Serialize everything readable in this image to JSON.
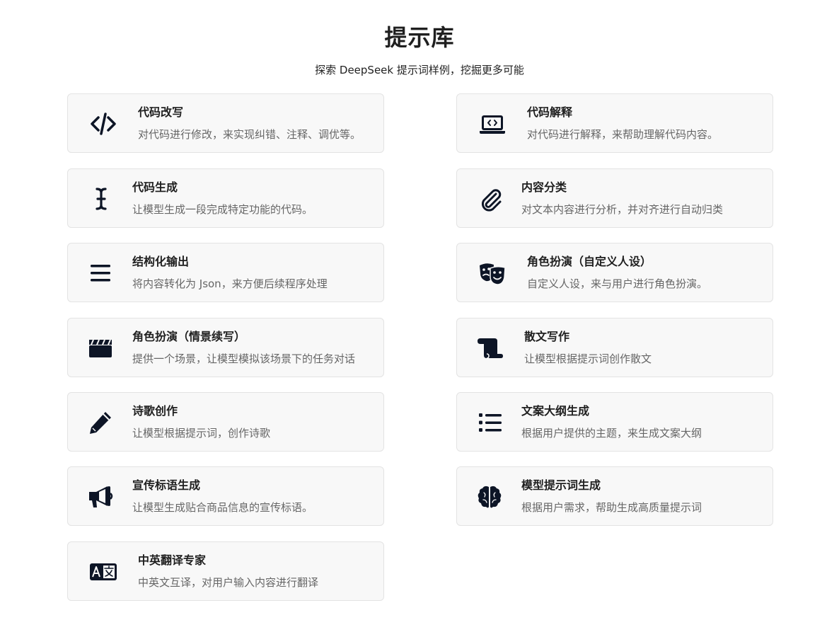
{
  "header": {
    "title": "提示库",
    "subtitle": "探索 DeepSeek 提示词样例，挖掘更多可能"
  },
  "cards": [
    {
      "title": "代码改写",
      "desc": "对代码进行修改，来实现纠错、注释、调优等。",
      "icon": "code-icon"
    },
    {
      "title": "代码解释",
      "desc": "对代码进行解释，来帮助理解代码内容。",
      "icon": "laptop-code-icon"
    },
    {
      "title": "代码生成",
      "desc": "让模型生成一段完成特定功能的代码。",
      "icon": "text-cursor-icon"
    },
    {
      "title": "内容分类",
      "desc": "对文本内容进行分析，并对齐进行自动归类",
      "icon": "paperclip-icon"
    },
    {
      "title": "结构化输出",
      "desc": "将内容转化为 Json，来方便后续程序处理",
      "icon": "bars-icon"
    },
    {
      "title": "角色扮演（自定义人设）",
      "desc": "自定义人设，来与用户进行角色扮演。",
      "icon": "theater-masks-icon"
    },
    {
      "title": "角色扮演（情景续写）",
      "desc": "提供一个场景，让模型模拟该场景下的任务对话",
      "icon": "clapperboard-icon"
    },
    {
      "title": "散文写作",
      "desc": "让模型根据提示词创作散文",
      "icon": "scroll-icon"
    },
    {
      "title": "诗歌创作",
      "desc": "让模型根据提示词，创作诗歌",
      "icon": "pencil-icon"
    },
    {
      "title": "文案大纲生成",
      "desc": "根据用户提供的主题，来生成文案大纲",
      "icon": "list-icon"
    },
    {
      "title": "宣传标语生成",
      "desc": "让模型生成贴合商品信息的宣传标语。",
      "icon": "megaphone-icon"
    },
    {
      "title": "模型提示词生成",
      "desc": "根据用户需求，帮助生成高质量提示词",
      "icon": "brain-icon"
    },
    {
      "title": "中英翻译专家",
      "desc": "中英文互译，对用户输入内容进行翻译",
      "icon": "language-icon"
    }
  ]
}
